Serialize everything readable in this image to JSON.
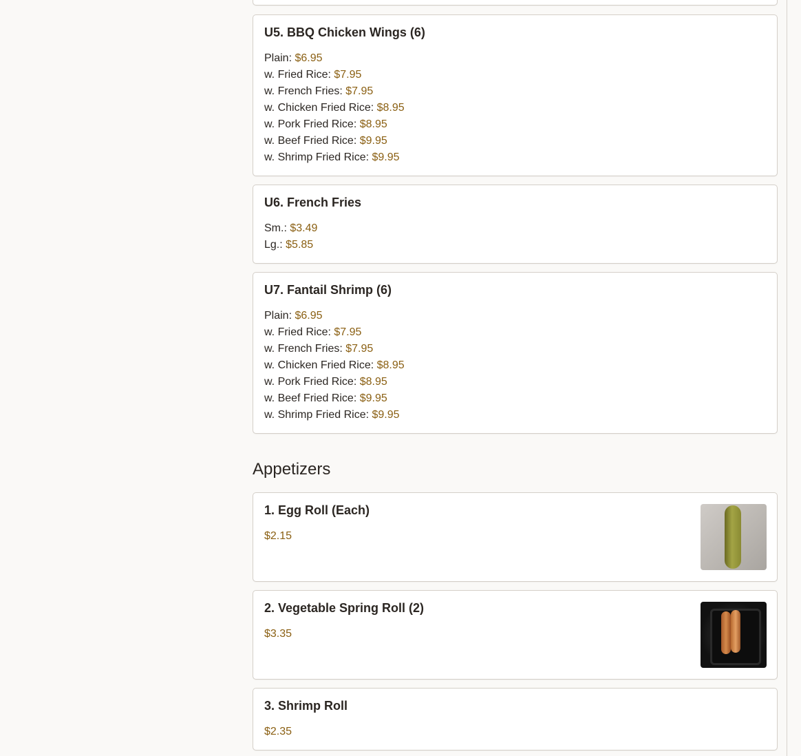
{
  "sections": [
    {
      "items": [
        {
          "name": "U5. BBQ Chicken Wings (6)",
          "options": [
            {
              "label": "Plain: ",
              "price": "$6.95"
            },
            {
              "label": "w. Fried Rice: ",
              "price": "$7.95"
            },
            {
              "label": "w. French Fries: ",
              "price": "$7.95"
            },
            {
              "label": "w. Chicken Fried Rice: ",
              "price": "$8.95"
            },
            {
              "label": "w. Pork Fried Rice: ",
              "price": "$8.95"
            },
            {
              "label": "w. Beef Fried Rice: ",
              "price": "$9.95"
            },
            {
              "label": "w. Shrimp Fried Rice: ",
              "price": "$9.95"
            }
          ]
        },
        {
          "name": "U6. French Fries",
          "options": [
            {
              "label": "Sm.: ",
              "price": "$3.49"
            },
            {
              "label": "Lg.: ",
              "price": "$5.85"
            }
          ]
        },
        {
          "name": "U7. Fantail Shrimp (6)",
          "options": [
            {
              "label": "Plain: ",
              "price": "$6.95"
            },
            {
              "label": "w. Fried Rice: ",
              "price": "$7.95"
            },
            {
              "label": "w. French Fries: ",
              "price": "$7.95"
            },
            {
              "label": "w. Chicken Fried Rice: ",
              "price": "$8.95"
            },
            {
              "label": "w. Pork Fried Rice: ",
              "price": "$8.95"
            },
            {
              "label": "w. Beef Fried Rice: ",
              "price": "$9.95"
            },
            {
              "label": "w. Shrimp Fried Rice: ",
              "price": "$9.95"
            }
          ]
        }
      ]
    },
    {
      "title": "Appetizers",
      "items": [
        {
          "name": "1. Egg Roll (Each)",
          "price": "$2.15",
          "image": "egg-roll-photo"
        },
        {
          "name": "2. Vegetable Spring Roll (2)",
          "price": "$3.35",
          "image": "spring-roll-photo"
        },
        {
          "name": "3. Shrimp Roll",
          "price": "$2.35"
        }
      ]
    }
  ],
  "colors": {
    "page_background": "#faf9f7",
    "card_border": "#d4cfc8",
    "text": "#2b2622",
    "price": "#8a5f12"
  }
}
